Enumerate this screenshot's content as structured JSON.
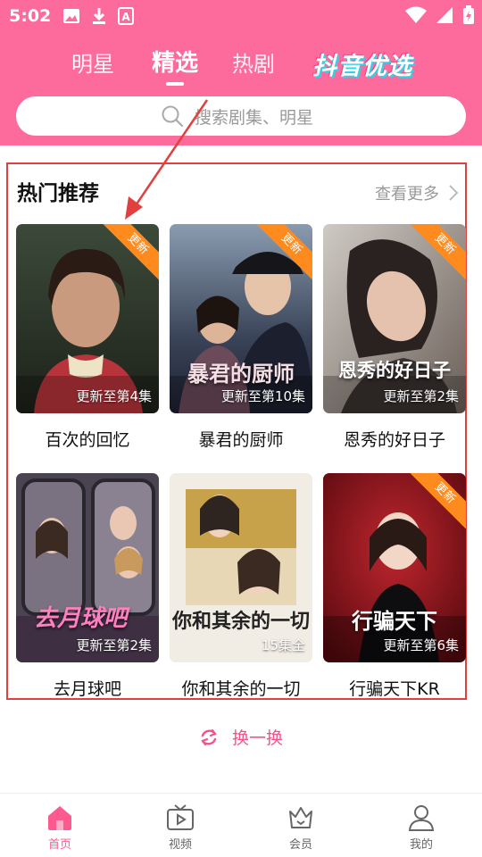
{
  "status_bar": {
    "time": "5:02",
    "left_icons": [
      "image-icon",
      "download-icon",
      "font-a-icon"
    ],
    "right_icons": [
      "wifi-icon",
      "signal-icon",
      "battery-icon"
    ]
  },
  "tabs": [
    {
      "label": "明星",
      "active": false
    },
    {
      "label": "精选",
      "active": true
    },
    {
      "label": "热剧",
      "active": false
    },
    {
      "label": "抖音优选",
      "active": false,
      "style": "brand-logo"
    }
  ],
  "search": {
    "placeholder": "搜索剧集、明星",
    "icon": "search-icon"
  },
  "section": {
    "title": "热门推荐",
    "more_label": "查看更多"
  },
  "cards": [
    {
      "title": "百次的回忆",
      "caption": "更新至第4集",
      "badge": "更新",
      "poster_text": ""
    },
    {
      "title": "暴君的厨师",
      "caption": "更新至第10集",
      "badge": "更新",
      "poster_text": "暴君的厨师"
    },
    {
      "title": "恩秀的好日子",
      "caption": "更新至第2集",
      "badge": "更新",
      "poster_text": "恩秀的好日子"
    },
    {
      "title": "去月球吧",
      "caption": "更新至第2集",
      "badge": "",
      "poster_text": "去月球吧"
    },
    {
      "title": "你和其余的一切",
      "caption": "15集全",
      "badge": "",
      "poster_text": "你和其余的一切"
    },
    {
      "title": "行骗天下KR",
      "caption": "更新至第6集",
      "badge": "更新",
      "poster_text": "行骗天下"
    }
  ],
  "refresh_label": "换一换",
  "bottom_nav": [
    {
      "label": "首页",
      "icon": "home-icon",
      "active": true
    },
    {
      "label": "视频",
      "icon": "tv-icon",
      "active": false
    },
    {
      "label": "会员",
      "icon": "crown-icon",
      "active": false
    },
    {
      "label": "我的",
      "icon": "user-icon",
      "active": false
    }
  ],
  "colors": {
    "header": "#fd6a9c",
    "accent": "#fd5b8f",
    "badge": "#ff8a1e",
    "annotation": "#e0403f"
  }
}
